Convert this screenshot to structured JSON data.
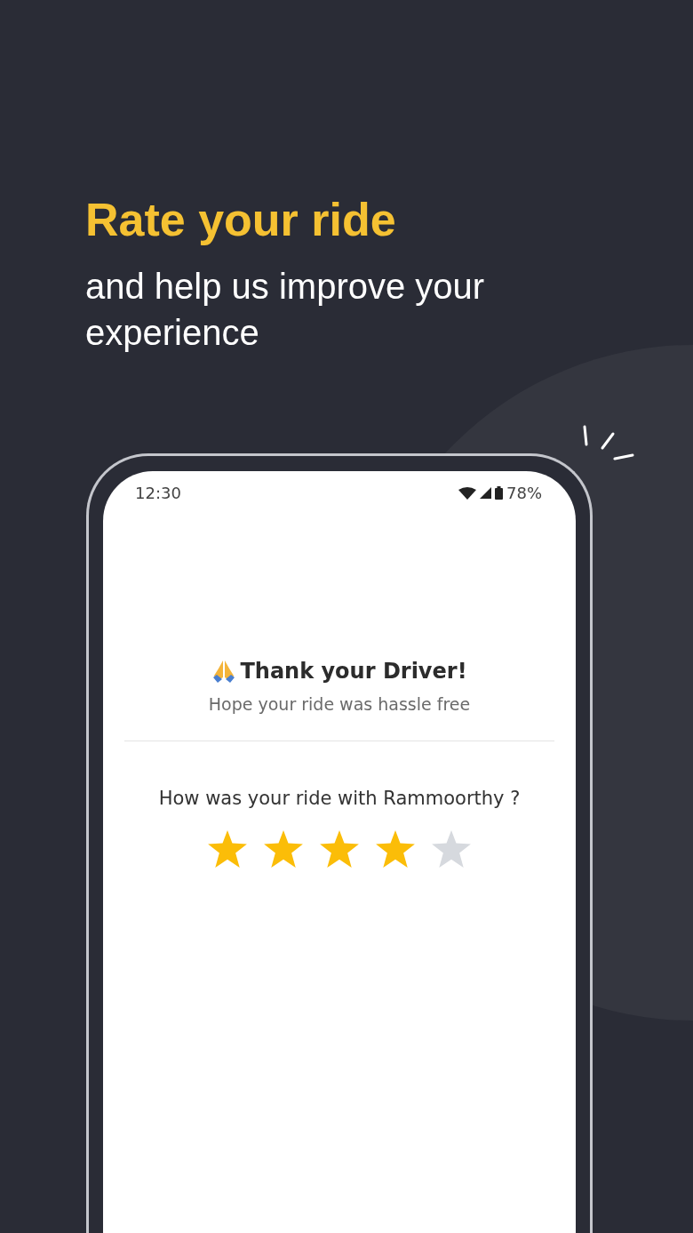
{
  "headline": "Rate your ride",
  "subheadline": "and help us improve your experience",
  "phone": {
    "status_bar": {
      "time": "12:30",
      "battery": "78%"
    },
    "title": "Thank your Driver!",
    "subtitle": "Hope your ride was hassle free",
    "question": "How was your ride with Rammoorthy ?",
    "stars": 4
  }
}
